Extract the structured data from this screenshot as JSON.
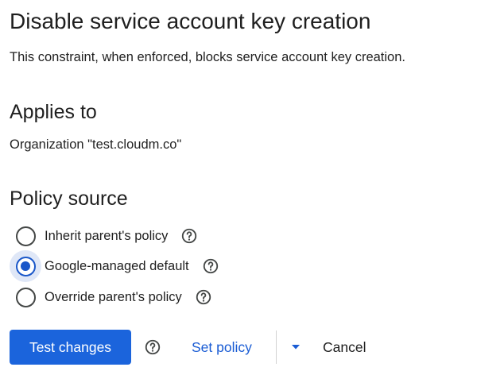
{
  "policy": {
    "title": "Disable service account key creation",
    "description": "This constraint, when enforced, blocks service account key creation."
  },
  "applies_to": {
    "heading": "Applies to",
    "value": "Organization \"test.cloudm.co\""
  },
  "policy_source": {
    "heading": "Policy source",
    "selected_index": 1,
    "options": [
      {
        "label": "Inherit parent's policy",
        "icon": "help-icon"
      },
      {
        "label": "Google-managed default",
        "icon": "help-icon"
      },
      {
        "label": "Override parent's policy",
        "icon": "help-icon"
      }
    ]
  },
  "actions": {
    "test_changes_label": "Test changes",
    "set_policy_label": "Set policy",
    "cancel_label": "Cancel",
    "help_icon": "help-icon",
    "dropdown_icon": "caret-down-icon"
  },
  "colors": {
    "primary": "#1b64dc",
    "link": "#1a5cd4",
    "radio_selected": "#1a57c9",
    "radio_halo": "#dfe7f7",
    "text": "#1f1f1f"
  }
}
